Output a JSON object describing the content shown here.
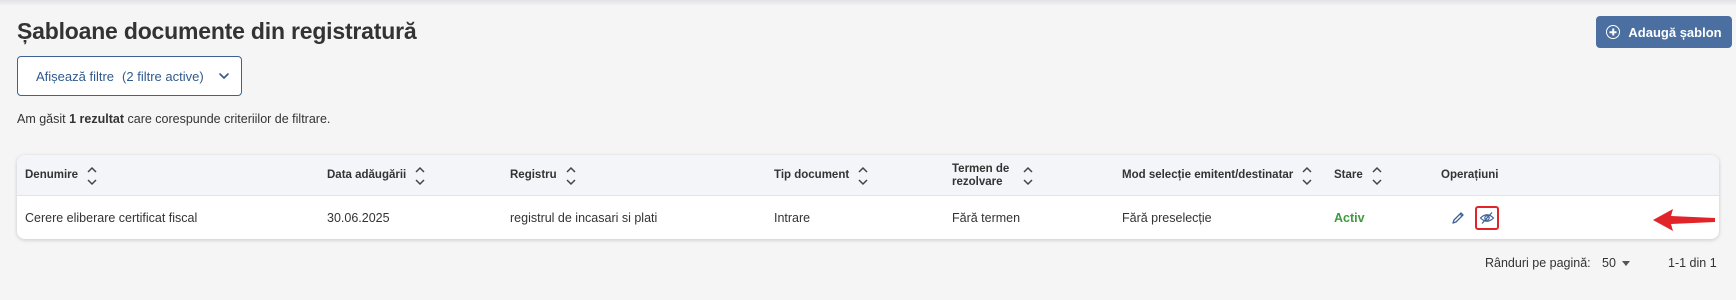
{
  "page": {
    "title": "Șabloane documente din registratură",
    "add_button_label": "Adaugă șablon"
  },
  "filters": {
    "button_label": "Afișează filtre",
    "active_count": "(2 filtre active)"
  },
  "results": {
    "prefix": "Am găsit",
    "count_text": "1 rezultat",
    "suffix": "care corespunde criteriilor de filtrare."
  },
  "table": {
    "columns": [
      {
        "label": "Denumire"
      },
      {
        "label": "Data adăugării"
      },
      {
        "label": "Registru"
      },
      {
        "label": "Tip document"
      },
      {
        "label": "Termen de rezolvare"
      },
      {
        "label": "Mod selecție emitent/destinatar"
      },
      {
        "label": "Stare"
      },
      {
        "label": "Operațiuni"
      }
    ],
    "rows": [
      {
        "name": "Cerere eliberare certificat fiscal",
        "date_added": "30.06.2025",
        "registry": "registrul de incasari si plati",
        "doc_type": "Intrare",
        "deadline": "Fără termen",
        "selection_mode": "Fără preselecție",
        "status": "Activ"
      }
    ]
  },
  "pagination": {
    "rows_per_page_label": "Rânduri pe pagină:",
    "rows_per_page_value": "50",
    "range": "1-1 din 1"
  },
  "colors": {
    "primary": "#4a6fa0",
    "status_active": "#3f9a3f",
    "highlight": "#e0242a"
  },
  "icons": {
    "add": "plus-circle-icon",
    "filter_toggle": "chevron-down-icon",
    "sort": "sort-arrows-icon",
    "edit": "pencil-icon",
    "hide": "eye-off-icon",
    "annotation": "red-arrow-icon"
  }
}
